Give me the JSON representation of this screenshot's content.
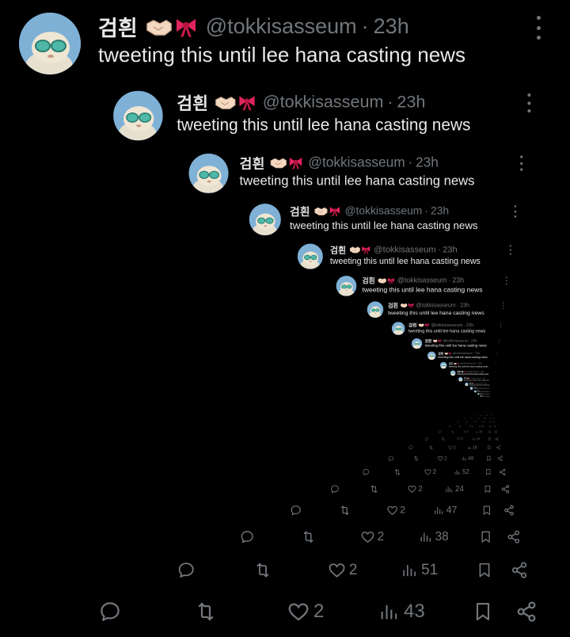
{
  "tweet": {
    "author_name": "검흰",
    "author_emojis": [
      "handshake-emoji",
      "ribbon-emoji"
    ],
    "handle": "@tokkisasseum",
    "separator": "·",
    "time": "23h",
    "text": "tweeting this until lee hana casting news"
  },
  "recursion_levels": [
    {
      "level": 0,
      "likes": "2",
      "views": "43"
    },
    {
      "level": 1,
      "likes": "2",
      "views": "51"
    },
    {
      "level": 2,
      "likes": "2",
      "views": "38"
    },
    {
      "level": 3,
      "likes": "2",
      "views": "47"
    },
    {
      "level": 4,
      "likes": "2",
      "views": "24"
    },
    {
      "level": 5,
      "likes": "2",
      "views": "52"
    },
    {
      "level": 6,
      "likes": "2",
      "views": "49"
    },
    {
      "level": 7,
      "likes": "2",
      "views": "19"
    }
  ],
  "icons": {
    "reply": "reply-icon",
    "retweet": "retweet-icon",
    "like": "heart-icon",
    "views": "views-icon",
    "bookmark": "bookmark-icon",
    "share": "share-icon",
    "more": "more-icon"
  },
  "colors": {
    "background": "#000000",
    "text": "#e7e9ea",
    "muted": "#71767b",
    "ribbon": "#e0245e",
    "avatar_bg": "#7fb0d6"
  }
}
